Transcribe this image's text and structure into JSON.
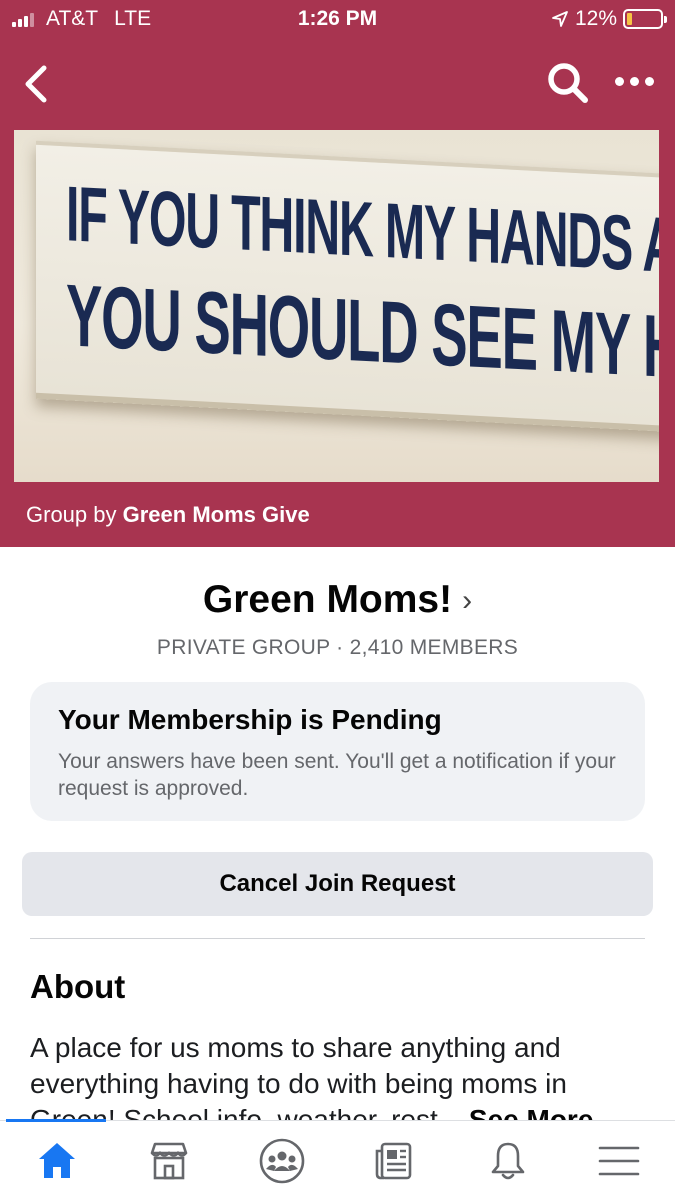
{
  "status_bar": {
    "carrier": "AT&T",
    "network": "LTE",
    "time": "1:26 PM",
    "battery": "12%",
    "battery_level": 0.12
  },
  "nav": {
    "back_icon": "chevron-left-icon",
    "search_icon": "search-icon",
    "more_icon": "more-horizontal-icon"
  },
  "cover": {
    "sign_line1": "IF YOU THINK MY HANDS ARE FULL,",
    "sign_line2": "YOU SHOULD SEE MY HEART♥"
  },
  "group_by": {
    "prefix": "Group by",
    "owner": "Green Moms Give"
  },
  "group": {
    "name": "Green Moms!",
    "meta": "PRIVATE GROUP · 2,410 MEMBERS"
  },
  "pending": {
    "title": "Your Membership is Pending",
    "text": "Your answers have been sent. You'll get a notification if your request is approved."
  },
  "cancel_button": "Cancel Join Request",
  "about": {
    "title": "About",
    "text": "A place for us moms to share anything and everything having to do with being moms in Green! School info, weather, rest...",
    "see_more": "See More"
  },
  "tabs": [
    {
      "icon": "home-icon",
      "active": true
    },
    {
      "icon": "marketplace-icon",
      "active": false
    },
    {
      "icon": "groups-icon",
      "active": false
    },
    {
      "icon": "news-feed-icon",
      "active": false
    },
    {
      "icon": "notifications-icon",
      "active": false
    },
    {
      "icon": "menu-icon",
      "active": false
    }
  ],
  "colors": {
    "brand": "#a83450",
    "active_tab": "#1877f2",
    "inactive_tab": "#65676b"
  }
}
